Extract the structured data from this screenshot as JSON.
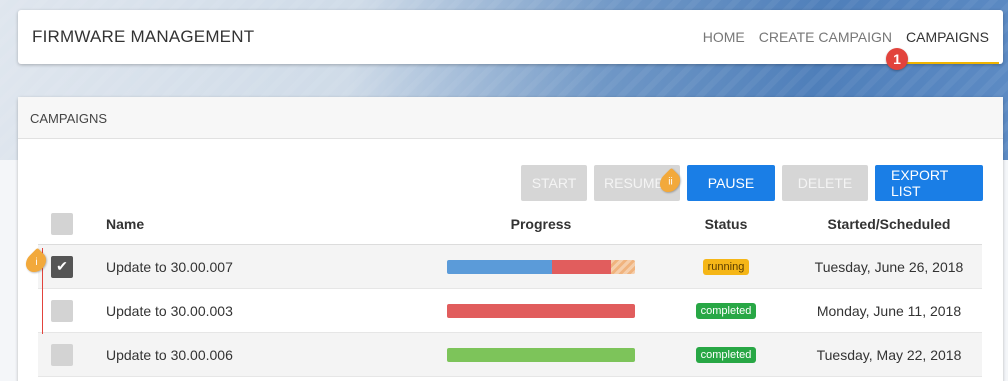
{
  "header": {
    "title": "FIRMWARE MANAGEMENT",
    "nav": [
      "HOME",
      "CREATE CAMPAIGN",
      "CAMPAIGNS"
    ],
    "active_nav": "CAMPAIGNS"
  },
  "markers": {
    "nav_marker": "1",
    "pause_marker": "ii",
    "row_marker": "i"
  },
  "panel": {
    "title": "CAMPAIGNS"
  },
  "toolbar": {
    "start": "START",
    "resume": "RESUME",
    "pause": "PAUSE",
    "delete": "DELETE",
    "export": "EXPORT LIST"
  },
  "table": {
    "columns": [
      "Name",
      "Progress",
      "Status",
      "Started/Scheduled"
    ],
    "rows": [
      {
        "name": "Update to 30.00.007",
        "status": "running",
        "date": "Tuesday, June 26, 2018",
        "checked": true,
        "progress": [
          {
            "color": "#5b9bd9",
            "fraction": 0.56
          },
          {
            "color": "#e15d5d",
            "fraction": 0.31
          },
          {
            "color": "#f0b37e",
            "fraction": 0.13
          }
        ]
      },
      {
        "name": "Update to 30.00.003",
        "status": "completed",
        "date": "Monday, June 11, 2018",
        "checked": false,
        "progress": [
          {
            "color": "#e15d5d",
            "fraction": 1.0
          }
        ]
      },
      {
        "name": "Update to 30.00.006",
        "status": "completed",
        "date": "Tuesday, May 22, 2018",
        "checked": false,
        "progress": [
          {
            "color": "#7dc45a",
            "fraction": 1.0
          }
        ]
      }
    ]
  },
  "colors": {
    "primary": "#1a7ee6",
    "accent": "#f0b400",
    "marker_red": "#e2433c",
    "marker_orange": "#f2a93b"
  }
}
